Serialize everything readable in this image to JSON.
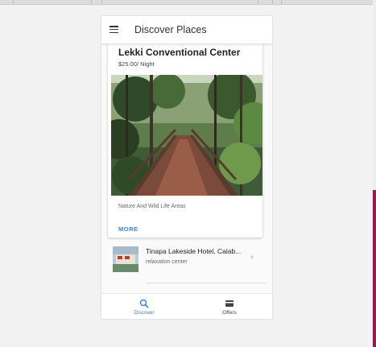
{
  "app": {
    "title": "Discover Places"
  },
  "featured_place": {
    "name": "Lekki Conventional Center",
    "price": "$25.00/ Night",
    "description": "Nature And Wild Life Areas",
    "more_label": "MORE"
  },
  "places_list": [
    {
      "name": "Tinapa Lakeside Hotel, Calab...",
      "subtitle": "relaxation center"
    }
  ],
  "bottom_nav": {
    "tabs": [
      {
        "label": "Discover",
        "icon": "search-icon",
        "active": true
      },
      {
        "label": "Offers",
        "icon": "card-icon",
        "active": false
      }
    ]
  },
  "colors": {
    "accent": "#3f7fcf",
    "edge_accent": "#a3154f"
  }
}
